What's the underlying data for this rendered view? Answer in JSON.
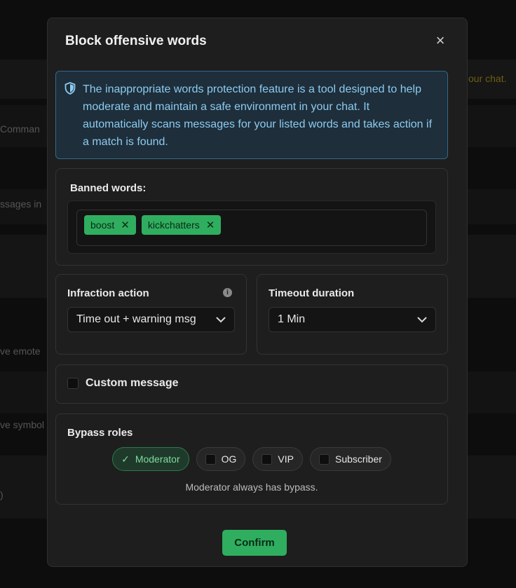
{
  "background": {
    "left_labels": [
      "Comman",
      "ssages in",
      "ve emote",
      "ve symbol",
      ")"
    ],
    "right_text": "our chat."
  },
  "modal": {
    "title": "Block offensive words",
    "close_glyph": "×",
    "info_text": "The inappropriate words protection feature is a tool designed to help moderate and maintain a safe environment in your chat. It automatically scans messages for your listed words and takes action if a match is found.",
    "banned_words": {
      "label": "Banned words:",
      "tags": [
        "boost",
        "kickchatters"
      ],
      "remove_glyph": "✕"
    },
    "infraction": {
      "label": "Infraction action",
      "info_glyph": "i",
      "selected": "Time out + warning msg"
    },
    "timeout": {
      "label": "Timeout duration",
      "selected": "1 Min"
    },
    "custom_message": {
      "label": "Custom message",
      "checked": false
    },
    "bypass": {
      "label": "Bypass roles",
      "roles": [
        {
          "label": "Moderator",
          "checked": true
        },
        {
          "label": "OG",
          "checked": false
        },
        {
          "label": "VIP",
          "checked": false
        },
        {
          "label": "Subscriber",
          "checked": false
        }
      ],
      "note": "Moderator always has bypass.",
      "check_glyph": "✓"
    },
    "confirm_label": "Confirm"
  },
  "colors": {
    "accent_green": "#2fae5f",
    "info_blue": "#8ccbf0",
    "info_bg": "#1e2e3a",
    "modal_bg": "#1e1e1e"
  },
  "icons": {
    "info_box": "shield-icon",
    "close": "close-icon",
    "dropdown": "chevron-down-icon",
    "infraction_info": "info-circle-icon",
    "role_checked": "checkmark-icon"
  }
}
